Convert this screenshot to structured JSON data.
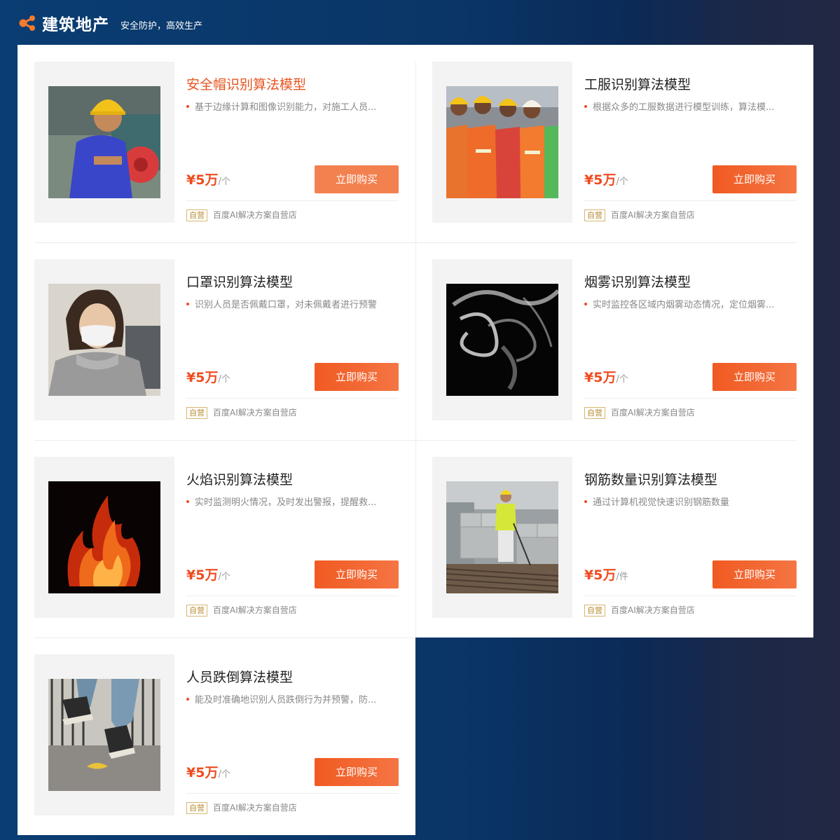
{
  "header": {
    "brand": "建筑地产",
    "slogan": "安全防护，高效生产",
    "logo_icon": "share-nodes-icon",
    "accent": "#f15a22"
  },
  "products": [
    {
      "title": "安全帽识别算法模型",
      "desc": "基于边缘计算和图像识别能力，对施工人员...",
      "price": "¥5万",
      "unit": "/个",
      "buy": "立即购买",
      "tag": "自营",
      "shop": "百度AI解决方案自营店",
      "image": "worker-hardhat-photo"
    },
    {
      "title": "工服识别算法模型",
      "desc": "根据众多的工服数据进行模型训练，算法模...",
      "price": "¥5万",
      "unit": "/个",
      "buy": "立即购买",
      "tag": "自营",
      "shop": "百度AI解决方案自营店",
      "image": "workers-vests-photo"
    },
    {
      "title": "口罩识别算法模型",
      "desc": "识别人员是否佩戴口罩，对未佩戴者进行预警",
      "price": "¥5万",
      "unit": "/个",
      "buy": "立即购买",
      "tag": "自营",
      "shop": "百度AI解决方案自营店",
      "image": "woman-mask-photo"
    },
    {
      "title": "烟雾识别算法模型",
      "desc": "实时监控各区域内烟雾动态情况，定位烟雾...",
      "price": "¥5万",
      "unit": "/个",
      "buy": "立即购买",
      "tag": "自营",
      "shop": "百度AI解决方案自营店",
      "image": "smoke-photo"
    },
    {
      "title": "火焰识别算法模型",
      "desc": "实时监测明火情况，及时发出警报，提醒救...",
      "price": "¥5万",
      "unit": "/个",
      "buy": "立即购买",
      "tag": "自营",
      "shop": "百度AI解决方案自营店",
      "image": "fire-photo"
    },
    {
      "title": "钢筋数量识别算法模型",
      "desc": "通过计算机视觉快速识别钢筋数量",
      "price": "¥5万",
      "unit": "/件",
      "buy": "立即购买",
      "tag": "自营",
      "shop": "百度AI解决方案自营店",
      "image": "rebar-site-photo"
    },
    {
      "title": "人员跌倒算法模型",
      "desc": "能及时准确地识别人员跌倒行为并预警，防...",
      "price": "¥5万",
      "unit": "/个",
      "buy": "立即购买",
      "tag": "自营",
      "shop": "百度AI解决方案自营店",
      "image": "slip-fall-photo"
    }
  ]
}
